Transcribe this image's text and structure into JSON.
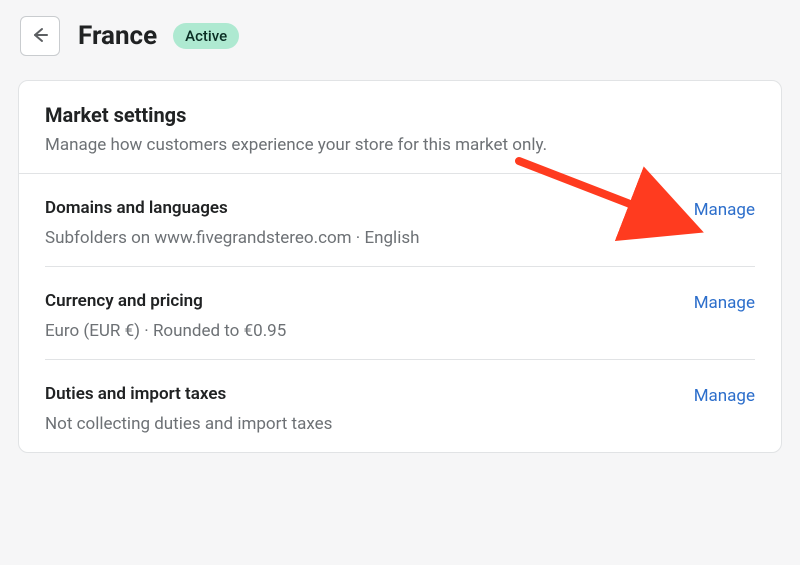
{
  "header": {
    "title": "France",
    "badge": "Active"
  },
  "card": {
    "title": "Market settings",
    "description": "Manage how customers experience your store for this market only."
  },
  "sections": [
    {
      "title": "Domains and languages",
      "subtitle": "Subfolders on www.fivegrandstereo.com · English",
      "action": "Manage"
    },
    {
      "title": "Currency and pricing",
      "subtitle": "Euro (EUR €) · Rounded to €0.95",
      "action": "Manage"
    },
    {
      "title": "Duties and import taxes",
      "subtitle": "Not collecting duties and import taxes",
      "action": "Manage"
    }
  ],
  "colors": {
    "link": "#2c6ecb",
    "badge_bg": "#aee9d1",
    "muted": "#6d7175",
    "arrow": "#ff3b1f"
  }
}
